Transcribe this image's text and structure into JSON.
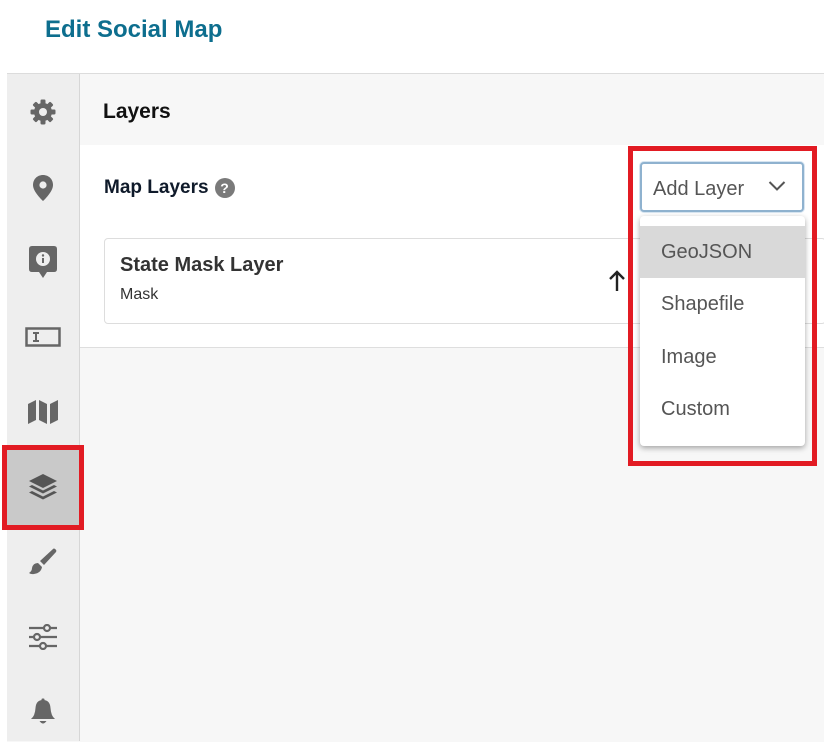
{
  "page": {
    "title": "Edit Social Map"
  },
  "sidebar": {
    "items": [
      {
        "icon": "gear-icon",
        "active": false
      },
      {
        "icon": "location-pin-icon",
        "active": false
      },
      {
        "icon": "info-marker-icon",
        "active": false
      },
      {
        "icon": "text-field-icon",
        "active": false
      },
      {
        "icon": "map-icon",
        "active": false
      },
      {
        "icon": "layers-icon",
        "active": true
      },
      {
        "icon": "paintbrush-icon",
        "active": false
      },
      {
        "icon": "sliders-icon",
        "active": false
      },
      {
        "icon": "bell-icon",
        "active": false
      }
    ]
  },
  "main": {
    "section_title": "Layers",
    "map_layers_label": "Map Layers",
    "help_glyph": "?",
    "layers": [
      {
        "name": "State Mask Layer",
        "type": "Mask"
      }
    ],
    "add_layer": {
      "label": "Add Layer",
      "options": [
        "GeoJSON",
        "Shapefile",
        "Image",
        "Custom"
      ],
      "highlighted": "GeoJSON"
    }
  },
  "colors": {
    "title": "#0d6e8e",
    "highlight_border": "#e21b23",
    "sidebar_active": "#c9c9c9",
    "icon": "#666666"
  }
}
